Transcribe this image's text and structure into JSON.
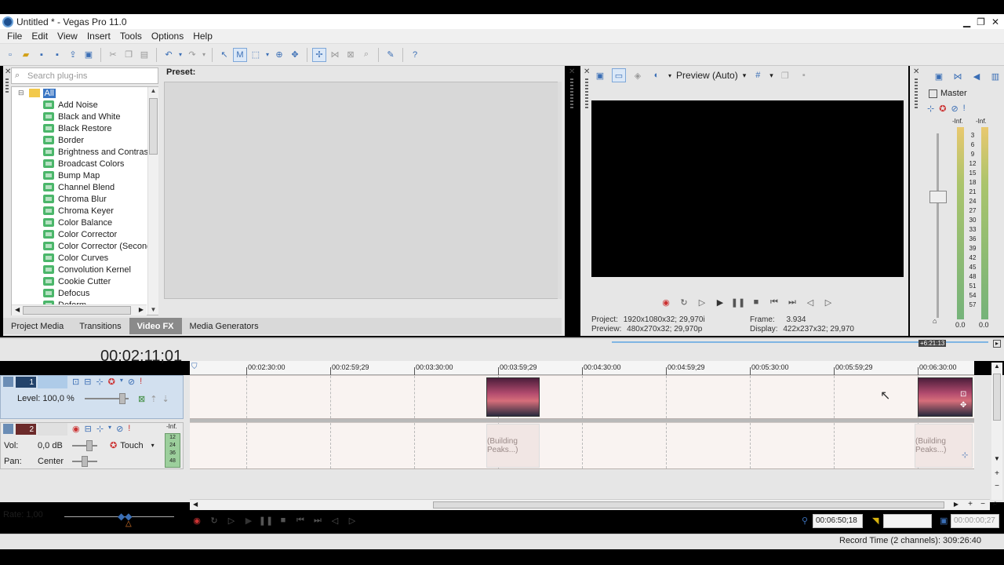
{
  "window": {
    "title": "Untitled * - Vegas Pro 11.0",
    "minimize": "▁",
    "restore": "❐",
    "close": "✕"
  },
  "menu": [
    "File",
    "Edit",
    "View",
    "Insert",
    "Tools",
    "Options",
    "Help"
  ],
  "toolbar_icons": [
    "new-icon",
    "open-icon",
    "save-icon",
    "save-as-icon",
    "render-icon",
    "properties-icon",
    "cut-icon",
    "copy-icon",
    "paste-icon",
    "undo-icon",
    "redo-icon",
    "normal-edit-tool-icon",
    "envelope-tool-icon",
    "selection-tool-icon",
    "zoom-tool-icon",
    "snap-icon",
    "auto-crossfade-icon",
    "auto-ripple-icon",
    "lock-envelopes-icon",
    "ignore-grouping-icon",
    "enable-snapping-icon",
    "help-icon"
  ],
  "plugins": {
    "search_placeholder": "Search plug-ins",
    "root": "All",
    "items": [
      "Add Noise",
      "Black and White",
      "Black Restore",
      "Border",
      "Brightness and Contrast",
      "Broadcast Colors",
      "Bump Map",
      "Channel Blend",
      "Chroma Blur",
      "Chroma Keyer",
      "Color Balance",
      "Color Corrector",
      "Color Corrector (Seconda",
      "Color Curves",
      "Convolution Kernel",
      "Cookie Cutter",
      "Defocus",
      "Deform"
    ],
    "preset_label": "Preset:"
  },
  "tabs": [
    {
      "label": "Project Media",
      "active": false
    },
    {
      "label": "Transitions",
      "active": false
    },
    {
      "label": "Video FX",
      "active": true
    },
    {
      "label": "Media Generators",
      "active": false
    }
  ],
  "preview": {
    "mode": "Preview (Auto)",
    "project_label": "Project:",
    "project_value": "1920x1080x32; 29,970i",
    "preview_label": "Preview:",
    "preview_value": "480x270x32; 29,970p",
    "frame_label": "Frame:",
    "frame_value": "3.934",
    "display_label": "Display:",
    "display_value": "422x237x32; 29,970"
  },
  "master": {
    "title": "Master",
    "inf_left": "-Inf.",
    "inf_right": "-Inf.",
    "scale": [
      "3",
      "6",
      "9",
      "12",
      "15",
      "18",
      "21",
      "24",
      "27",
      "30",
      "33",
      "36",
      "39",
      "42",
      "45",
      "48",
      "51",
      "54",
      "57"
    ],
    "val_left": "0.0",
    "val_right": "0.0"
  },
  "timeline": {
    "timecode": "00:02:11;01",
    "marker_tag": "+6:21:13",
    "ruler": [
      "00:02:30:00",
      "00:02:59;29",
      "00:03:30:00",
      "00:03:59;29",
      "00:04:30:00",
      "00:04:59;29",
      "00:05:30:00",
      "00:05:59;29",
      "00:06:30:00"
    ],
    "video_track": {
      "number": "1",
      "level_label": "Level: 100,0 %"
    },
    "audio_track": {
      "number": "2",
      "vol_label": "Vol:",
      "vol_value": "0,0 dB",
      "pan_label": "Pan:",
      "pan_value": "Center",
      "automation": "Touch",
      "inf": "-Inf.",
      "meter_nums": [
        "12",
        "24",
        "36",
        "48"
      ]
    },
    "audio_clip_label": "(Building Peaks...)",
    "audio_clip_label2": "(Building Peaks...)",
    "rate": "Rate: 1,00",
    "cursor_time": "00:06:50;18",
    "selection_length": "00:00:00;27",
    "record_time": "Record Time (2 channels): 309:26:40"
  }
}
